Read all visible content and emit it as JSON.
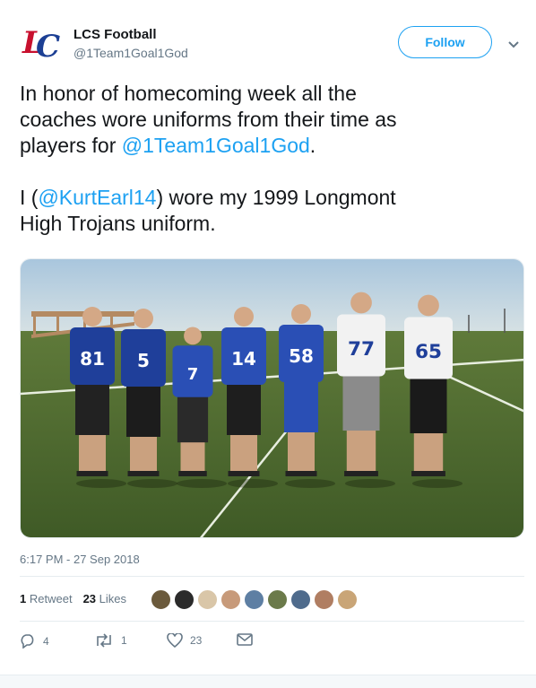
{
  "account": {
    "name": "LCS Football",
    "handle": "@1Team1Goal1God",
    "follow_label": "Follow"
  },
  "tweet": {
    "line1": "In honor of homecoming week all the",
    "line2": "coaches wore uniforms from their time as",
    "line3_prefix": "players for ",
    "line3_mention": "@1Team1Goal1God",
    "line3_suffix": ".",
    "line4_prefix": "I (",
    "line4_mention": "@KurtEarl14",
    "line4_suffix": ") wore my 1999 Longmont",
    "line5": "High Trojans uniform."
  },
  "photo": {
    "jerseys": [
      "81",
      "5",
      "7",
      "14",
      "58",
      "77",
      "65"
    ]
  },
  "timestamp": "6:17 PM - 27 Sep 2018",
  "stats": {
    "retweets": "1",
    "retweets_label": "Retweet",
    "likes": "23",
    "likes_label": "Likes"
  },
  "actions": {
    "replies": "4",
    "retweets": "1",
    "likes": "23"
  },
  "colors": {
    "accent": "#1da1f2",
    "text": "#14171a",
    "muted": "#657786"
  }
}
